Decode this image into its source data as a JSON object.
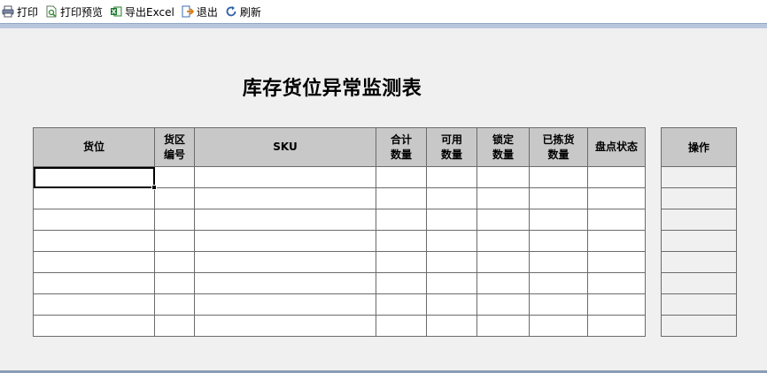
{
  "toolbar": {
    "items": [
      {
        "label": "打印",
        "icon": "printer-icon"
      },
      {
        "label": "打印预览",
        "icon": "print-preview-icon"
      },
      {
        "label": "导出Excel",
        "icon": "excel-icon"
      },
      {
        "label": "退出",
        "icon": "exit-icon"
      },
      {
        "label": "刷新",
        "icon": "refresh-icon"
      }
    ]
  },
  "report": {
    "title": "库存货位异常监测表",
    "columns": [
      {
        "line1": "货位",
        "line2": ""
      },
      {
        "line1": "货区",
        "line2": "编号"
      },
      {
        "line1": "SKU",
        "line2": ""
      },
      {
        "line1": "合计",
        "line2": "数量"
      },
      {
        "line1": "可用",
        "line2": "数量"
      },
      {
        "line1": "锁定",
        "line2": "数量"
      },
      {
        "line1": "已拣货",
        "line2": "数量"
      },
      {
        "line1": "盘点状态",
        "line2": ""
      }
    ],
    "operation_header": "操作",
    "rows": [
      [
        "",
        "",
        "",
        "",
        "",
        "",
        "",
        ""
      ],
      [
        "",
        "",
        "",
        "",
        "",
        "",
        "",
        ""
      ],
      [
        "",
        "",
        "",
        "",
        "",
        "",
        "",
        ""
      ],
      [
        "",
        "",
        "",
        "",
        "",
        "",
        "",
        ""
      ],
      [
        "",
        "",
        "",
        "",
        "",
        "",
        "",
        ""
      ],
      [
        "",
        "",
        "",
        "",
        "",
        "",
        "",
        ""
      ],
      [
        "",
        "",
        "",
        "",
        "",
        "",
        "",
        ""
      ],
      [
        "",
        "",
        "",
        "",
        "",
        "",
        "",
        ""
      ]
    ]
  },
  "colors": {
    "header_bg": "#c8c8c8",
    "toolbar_strip": "#b7c6dd",
    "background": "#f0f0f0"
  }
}
